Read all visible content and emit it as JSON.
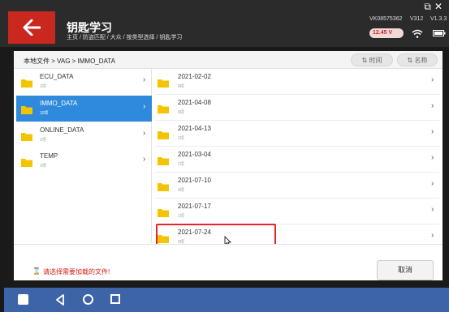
{
  "header": {
    "title": "钥匙学习",
    "breadcrumb": "主页 / 防盗匹配 / 大众 / 按类型选择 / 钥匙学习",
    "vin": "VK08575362",
    "version_a": "V312",
    "version_b": "V1.3.3",
    "battery": "12.45 V",
    "window_controls": "⧉✕"
  },
  "path": {
    "label": "本地文件 > VAG > IMMO_DATA",
    "sort_time": "时间",
    "sort_name": "名称"
  },
  "left_items": [
    {
      "name": "ECU_DATA",
      "count": "1项"
    },
    {
      "name": "IMMO_DATA",
      "count": "10项"
    },
    {
      "name": "ONLINE_DATA",
      "count": "1项"
    },
    {
      "name": "TEMP",
      "count": "1项"
    }
  ],
  "right_items": [
    {
      "name": "2021-02-02",
      "count": "9项"
    },
    {
      "name": "2021-04-08",
      "count": "9项"
    },
    {
      "name": "2021-04-13",
      "count": "1项"
    },
    {
      "name": "2021-03-04",
      "count": "1项"
    },
    {
      "name": "2021-07-10",
      "count": "4项"
    },
    {
      "name": "2021-07-17",
      "count": "1项"
    },
    {
      "name": "2021-07-24",
      "count": "9项"
    }
  ],
  "hint": {
    "icon": "⌛",
    "text": "请选择需要加载的文件!"
  },
  "cancel_label": "取消",
  "colors": {
    "accent": "#c8281e",
    "selected": "#2f89dd",
    "navbar": "#3e64a8",
    "folder": "#f4c400"
  }
}
